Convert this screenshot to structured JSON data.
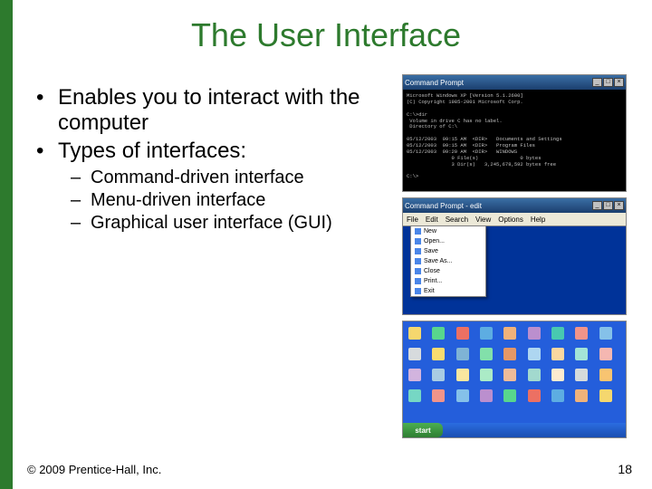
{
  "title": "The User Interface",
  "bullets": {
    "b1": "Enables you to interact with the computer",
    "b2": "Types of interfaces:",
    "s1": "Command-driven interface",
    "s2": "Menu-driven interface",
    "s3": "Graphical user interface (GUI)"
  },
  "footer": "© 2009 Prentice-Hall, Inc.",
  "page_number": "18",
  "images": {
    "cmd": {
      "title": "Command Prompt",
      "text": "Microsoft Windows XP [Version 5.1.2600]\n(C) Copyright 1985-2001 Microsoft Corp.\n\nC:\\>dir\n Volume in drive C has no label.\n Directory of C:\\\n\n05/12/2003  09:15 AM  <DIR>   Documents and Settings\n05/12/2003  09:15 AM  <DIR>   Program Files\n05/12/2003  09:20 AM  <DIR>   WINDOWS\n               0 File(s)              0 bytes\n               3 Dir(s)   3,245,678,592 bytes free\n\nC:\\>"
    },
    "menu": {
      "title": "Command Prompt - edit",
      "menubar": [
        "File",
        "Edit",
        "Search",
        "View",
        "Options",
        "Help"
      ],
      "dropdown": [
        "New",
        "Open...",
        "Save",
        "Save As...",
        "Close",
        "Print...",
        "Exit"
      ]
    },
    "gui": {
      "start": "start"
    }
  },
  "icon_colors": [
    "#f5d76e",
    "#58d68d",
    "#ec7063",
    "#5dade2",
    "#f0b27a",
    "#bb8fce",
    "#48c9b0",
    "#f1948a",
    "#85c1e9",
    "#d7dbdd",
    "#f7dc6f",
    "#7fb3d5",
    "#82e0aa",
    "#e59866",
    "#aed6f1",
    "#fad7a0",
    "#a3e4d7",
    "#f5b7b1",
    "#d2b4de",
    "#a9cce3",
    "#f9e79f",
    "#abebc6",
    "#edbb99",
    "#a2d9ce",
    "#fdebd0",
    "#d5dbdb",
    "#f8c471",
    "#76d7c4",
    "#f1948a",
    "#85c1e9",
    "#bb8fce",
    "#58d68d",
    "#ec7063",
    "#5dade2",
    "#f0b27a",
    "#f5d76e"
  ]
}
